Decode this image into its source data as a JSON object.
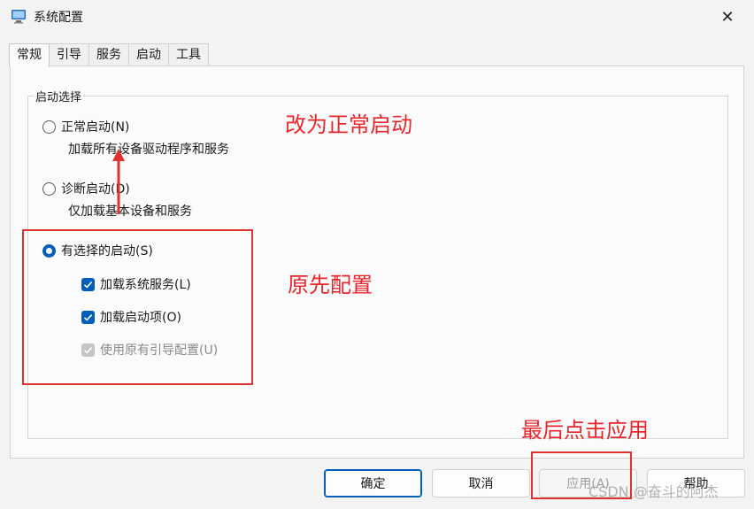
{
  "window": {
    "title": "系统配置",
    "close_icon": "close-icon"
  },
  "tabs": [
    {
      "label": "常规",
      "active": true
    },
    {
      "label": "引导"
    },
    {
      "label": "服务"
    },
    {
      "label": "启动"
    },
    {
      "label": "工具"
    }
  ],
  "startup_selection": {
    "legend": "启动选择",
    "normal": {
      "label": "正常启动(N)",
      "desc": "加载所有设备驱动程序和服务",
      "checked": false
    },
    "diagnostic": {
      "label": "诊断启动(D)",
      "desc": "仅加载基本设备和服务",
      "checked": false
    },
    "selective": {
      "label": "有选择的启动(S)",
      "checked": true,
      "load_system_services": {
        "label": "加载系统服务(L)",
        "checked": true
      },
      "load_startup_items": {
        "label": "加载启动项(O)",
        "checked": true
      },
      "use_original_boot_config": {
        "label": "使用原有引导配置(U)",
        "checked": true,
        "disabled": true
      }
    }
  },
  "annotations": {
    "change_to_normal": "改为正常启动",
    "original_config": "原先配置",
    "click_apply_last": "最后点击应用"
  },
  "buttons": {
    "ok": "确定",
    "cancel": "取消",
    "apply": "应用(A)",
    "help": "帮助"
  },
  "watermark": "CSDN @奋斗的阿杰",
  "colors": {
    "accent": "#005fb8",
    "annotation": "#e8262b"
  }
}
